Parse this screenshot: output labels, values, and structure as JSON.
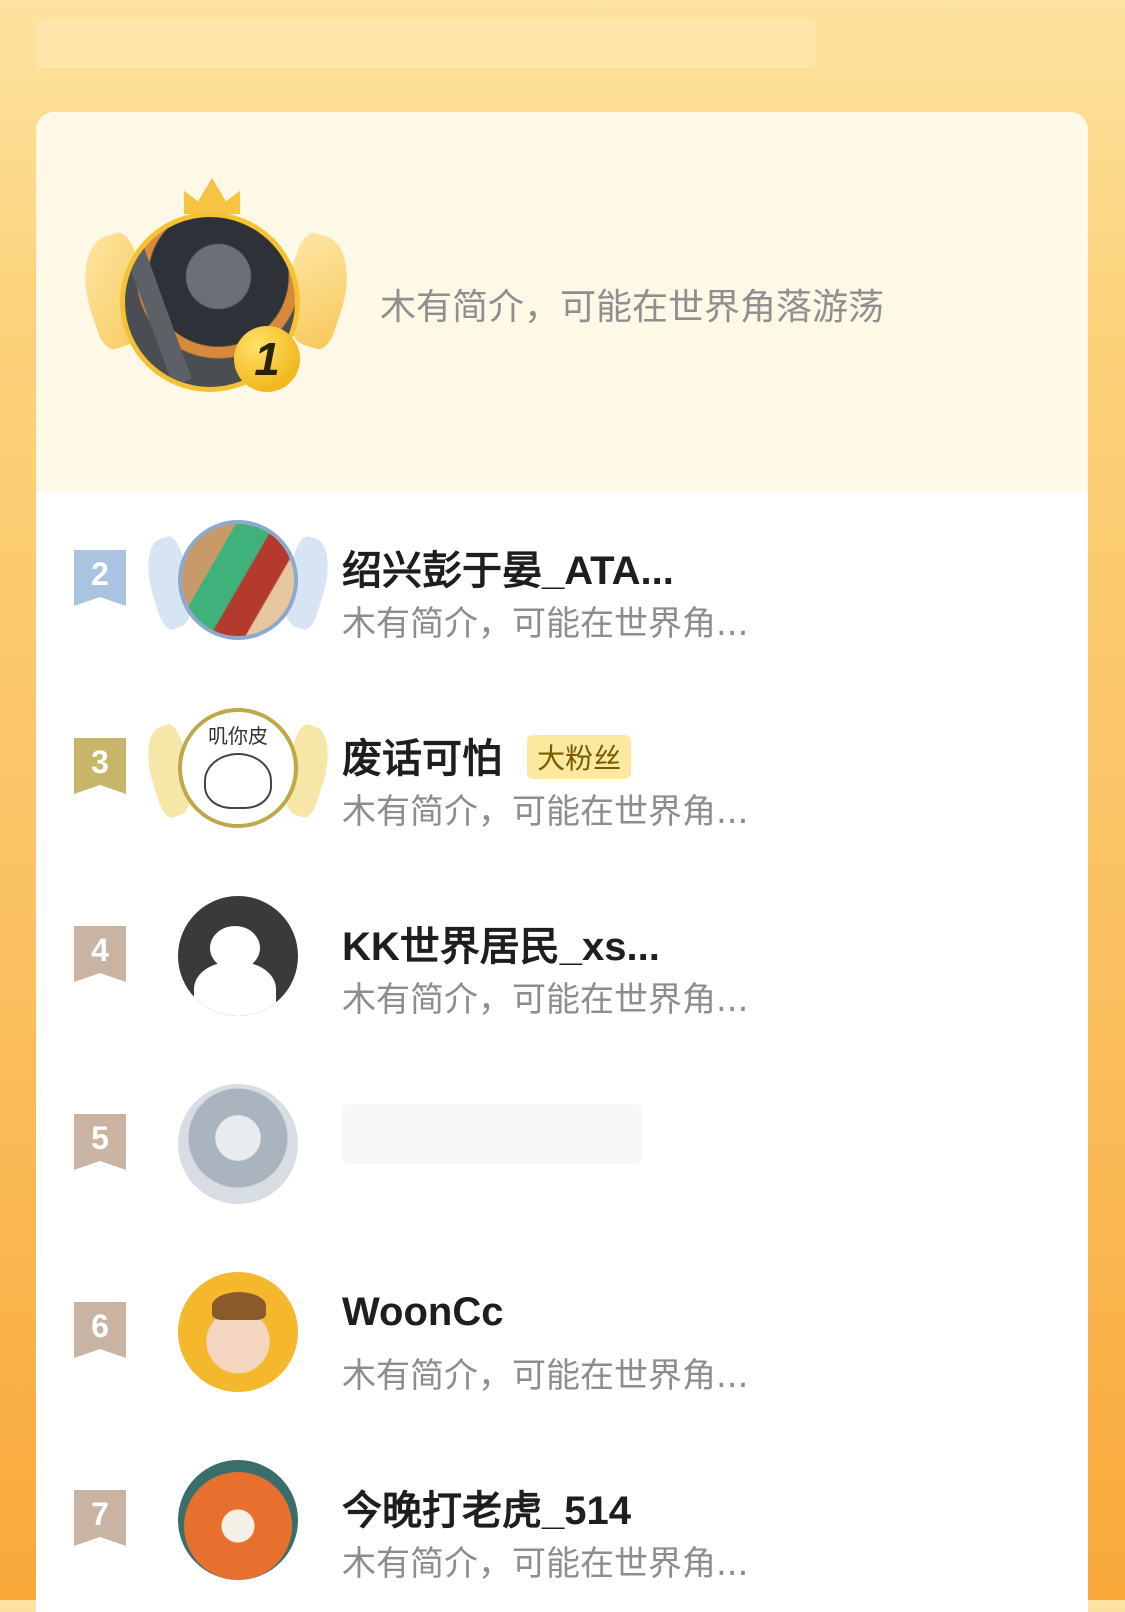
{
  "colors": {
    "accent_gold": "#f5c233",
    "rank2": "#a9c3e0",
    "rank3": "#c7b56a",
    "rank_other": "#c9b3a3"
  },
  "top": {
    "rank": "1",
    "description": "木有简介，可能在世界角落游荡"
  },
  "list": [
    {
      "rank": "2",
      "name": "绍兴彭于晏_ATA...",
      "description": "木有简介，可能在世界角..."
    },
    {
      "rank": "3",
      "name": "废话可怕",
      "badge": "大粉丝",
      "description": "木有简介，可能在世界角...",
      "avatar_text": "叽你皮"
    },
    {
      "rank": "4",
      "name": "KK世界居民_xs...",
      "description": "木有简介，可能在世界角..."
    },
    {
      "rank": "5",
      "name": "",
      "description": ""
    },
    {
      "rank": "6",
      "name": "WoonCc",
      "description": "木有简介，可能在世界角..."
    },
    {
      "rank": "7",
      "name": "今晚打老虎_514",
      "description": "木有简介，可能在世界角..."
    }
  ]
}
